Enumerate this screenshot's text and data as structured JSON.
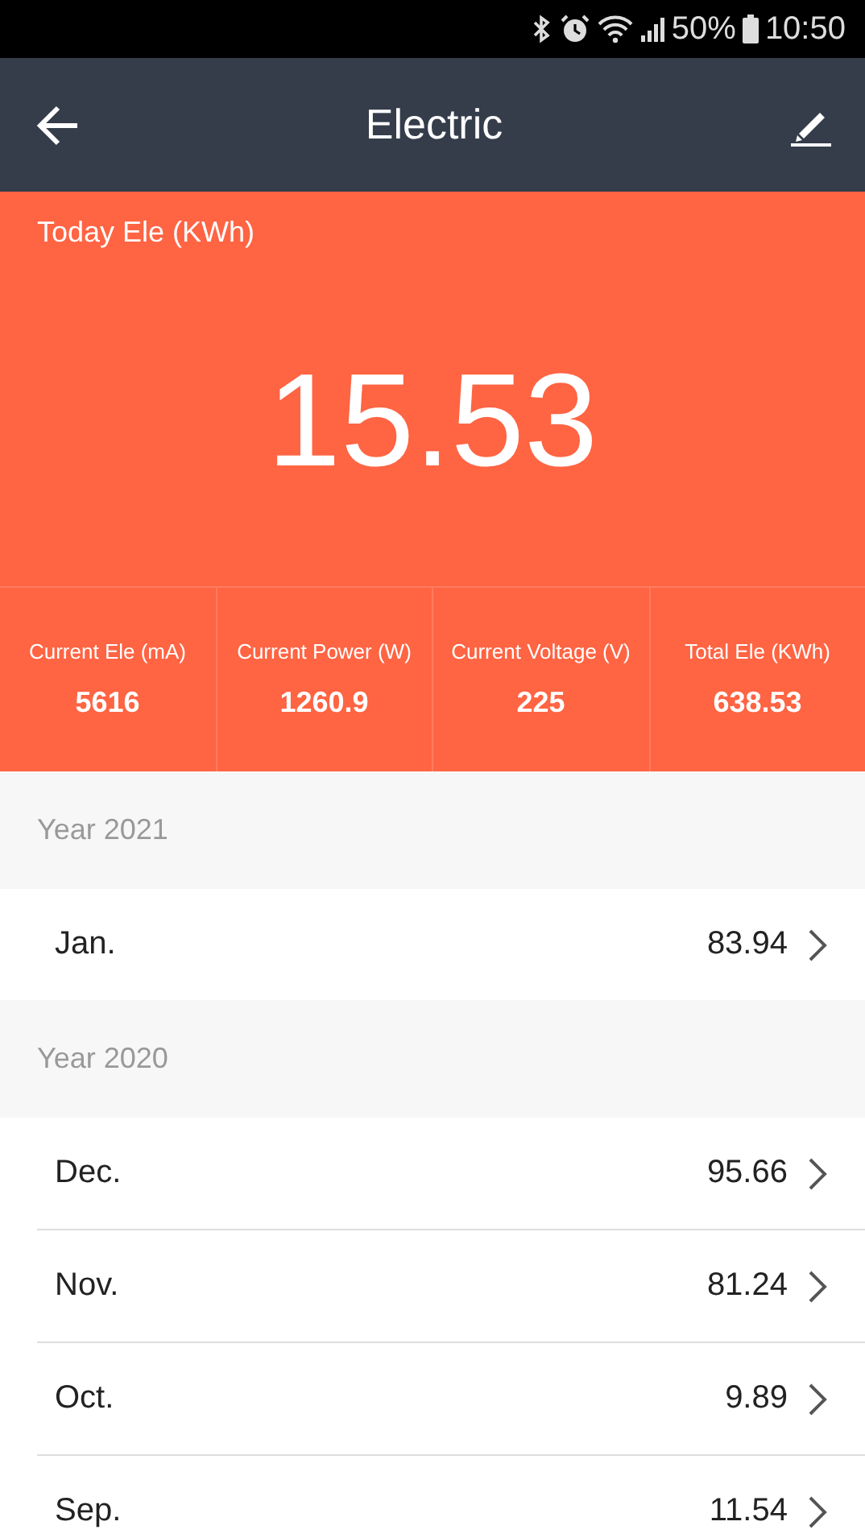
{
  "status_bar": {
    "battery_text": "50%",
    "time": "10:50"
  },
  "header": {
    "title": "Electric"
  },
  "today": {
    "label": "Today Ele (KWh)",
    "value": "15.53"
  },
  "stats": [
    {
      "label": "Current Ele (mA)",
      "value": "5616"
    },
    {
      "label": "Current Power (W)",
      "value": "1260.9"
    },
    {
      "label": "Current Voltage (V)",
      "value": "225"
    },
    {
      "label": "Total Ele (KWh)",
      "value": "638.53"
    }
  ],
  "sections": [
    {
      "title": "Year 2021",
      "months": [
        {
          "name": "Jan.",
          "value": "83.94"
        }
      ]
    },
    {
      "title": "Year 2020",
      "months": [
        {
          "name": "Dec.",
          "value": "95.66"
        },
        {
          "name": "Nov.",
          "value": "81.24"
        },
        {
          "name": "Oct.",
          "value": "9.89"
        },
        {
          "name": "Sep.",
          "value": "11.54"
        }
      ]
    }
  ]
}
